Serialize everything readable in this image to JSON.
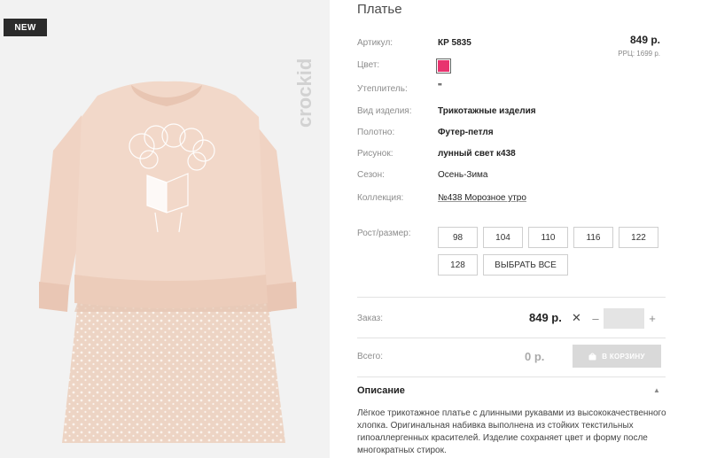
{
  "badge": "NEW",
  "brand": "crockid",
  "product": {
    "title": "Платье",
    "price": "849 р.",
    "rrp": "РРЦ: 1699 р."
  },
  "attributes": [
    {
      "label": "Артикул:",
      "value": "КР 5835"
    },
    {
      "label": "Цвет:",
      "value": "",
      "swatch": "#e8336f"
    },
    {
      "label": "Утеплитель:",
      "value": "\""
    },
    {
      "label": "Вид изделия:",
      "value": "Трикотажные изделия"
    },
    {
      "label": "Полотно:",
      "value": "Футер-петля"
    },
    {
      "label": "Рисунок:",
      "value": "лунный свет к438"
    },
    {
      "label": "Сезон:",
      "value": "Осень-Зима"
    },
    {
      "label": "Коллекция:",
      "value": "№438 Морозное утро"
    }
  ],
  "sizes": {
    "label": "Рост/размер:",
    "options": [
      "98",
      "104",
      "110",
      "116",
      "122",
      "128"
    ],
    "select_all": "ВЫБРАТЬ ВСЕ"
  },
  "order": {
    "label": "Заказ:",
    "price": "849 р.",
    "times": "✕",
    "minus": "–",
    "plus": "+",
    "quantity": ""
  },
  "total": {
    "label": "Всего:",
    "value": "0 р.",
    "cart_button": "В КОРЗИНУ"
  },
  "description": {
    "title": "Описание",
    "toggle": "▲",
    "text": "Лёгкое трикотажное платье с длинными рукавами из высококачественного хлопка. Оригинальная набивка выполнена из стойких текстильных гипоаллергенных красителей. Изделие сохраняет цвет и форму после многократных стирок."
  },
  "colors": {
    "accent_swatch": "#e8336f",
    "cart_button_bg": "#d9d9d9",
    "badge_bg": "#2b2b2b"
  }
}
